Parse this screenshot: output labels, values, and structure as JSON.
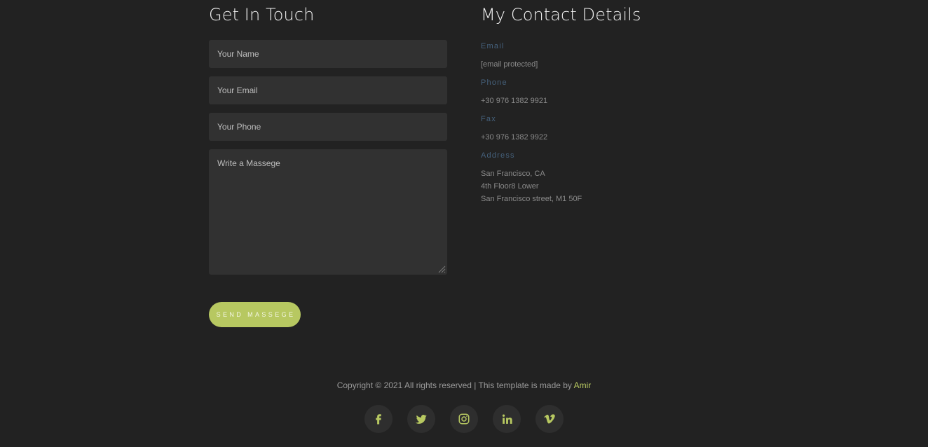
{
  "contact_form": {
    "title": "Get In Touch",
    "name_placeholder": "Your Name",
    "email_placeholder": "Your Email",
    "phone_placeholder": "Your Phone",
    "message_placeholder": "Write a Massege",
    "submit_label": "SEND MASSEGE"
  },
  "contact_details": {
    "title": "My Contact Details",
    "email_label": "Email",
    "email_value": "[email protected]",
    "phone_label": "Phone",
    "phone_value": "+30 976 1382 9921",
    "fax_label": "Fax",
    "fax_value": "+30 976 1382 9922",
    "address_label": "Address",
    "address_lines": [
      "San Francisco, CA",
      "4th Floor8 Lower",
      "San Francisco street, M1 50F"
    ]
  },
  "footer": {
    "copyright": "Copyright © 2021 All rights reserved | This template is made by ",
    "author": "Amir"
  },
  "socials": [
    {
      "icon": "facebook-icon"
    },
    {
      "icon": "twitter-icon"
    },
    {
      "icon": "instagram-icon"
    },
    {
      "icon": "linkedin-icon"
    },
    {
      "icon": "vimeo-icon"
    }
  ],
  "colors": {
    "background": "#222222",
    "input_bg": "#313131",
    "accent": "#b7c861",
    "label": "#45617c"
  }
}
